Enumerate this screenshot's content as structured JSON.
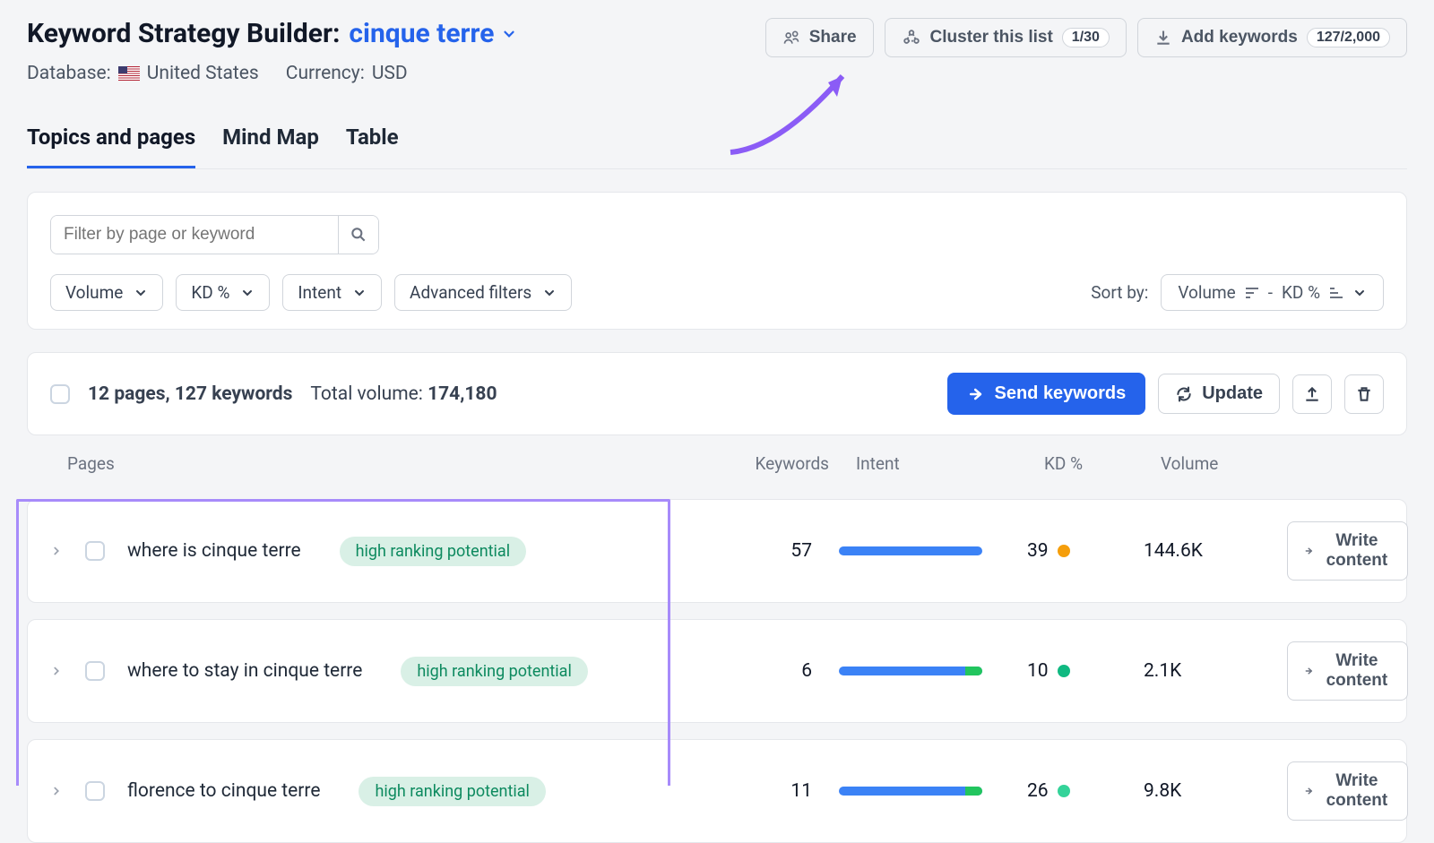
{
  "header": {
    "title_prefix": "Keyword Strategy Builder:",
    "project_name": "cinque terre",
    "database_label": "Database:",
    "database_value": "United States",
    "currency_label": "Currency:",
    "currency_value": "USD",
    "share_label": "Share",
    "cluster_label": "Cluster this list",
    "cluster_count": "1/30",
    "add_keywords_label": "Add keywords",
    "add_keywords_count": "127/2,000"
  },
  "tabs": {
    "topics": "Topics and pages",
    "mindmap": "Mind Map",
    "table": "Table"
  },
  "filters": {
    "search_placeholder": "Filter by page or keyword",
    "volume": "Volume",
    "kd": "KD %",
    "intent": "Intent",
    "advanced": "Advanced filters",
    "sortby_label": "Sort by:",
    "sort_primary": "Volume",
    "sort_sep": "-",
    "sort_secondary": "KD %"
  },
  "summary": {
    "pages_count": "12 pages, 127 keywords",
    "total_volume_label": "Total volume:",
    "total_volume_value": "174,180",
    "send_keywords": "Send keywords",
    "update": "Update"
  },
  "columns": {
    "pages": "Pages",
    "keywords": "Keywords",
    "intent": "Intent",
    "kd": "KD %",
    "volume": "Volume"
  },
  "badge_text": "high ranking potential",
  "write_content": "Write content",
  "rows": [
    {
      "title": "where is cinque terre",
      "keywords": "57",
      "intent_green_pct": 0,
      "kd": "39",
      "kd_color": "#f59e0b",
      "volume": "144.6K"
    },
    {
      "title": "where to stay in cinque terre",
      "keywords": "6",
      "intent_green_pct": 12,
      "kd": "10",
      "kd_color": "#10b981",
      "volume": "2.1K"
    },
    {
      "title": "florence to cinque terre",
      "keywords": "11",
      "intent_green_pct": 12,
      "kd": "26",
      "kd_color": "#34d399",
      "volume": "9.8K"
    }
  ]
}
